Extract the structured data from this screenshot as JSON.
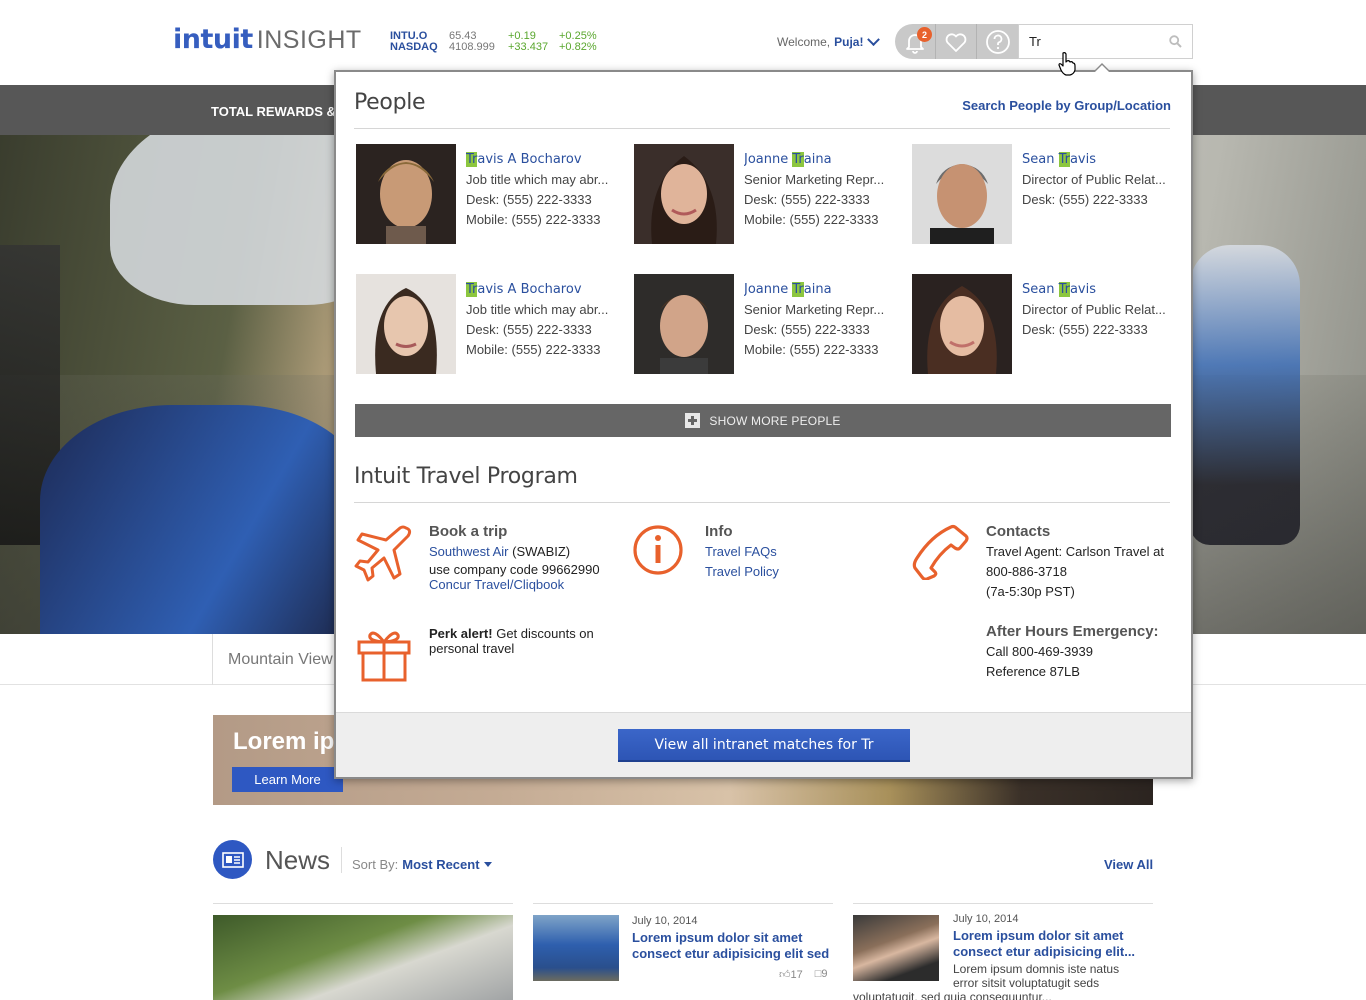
{
  "header": {
    "logo_main": "intuit",
    "logo_sub": "INSIGHT",
    "tickers": [
      {
        "name": "INTU.O",
        "value": "65.43",
        "change": "+0.19",
        "pct": "+0.25%"
      },
      {
        "name": "NASDAQ",
        "value": "4108.999",
        "change": "+33.437",
        "pct": "+0.82%"
      }
    ],
    "welcome": "Welcome,",
    "user": "Puja!",
    "notification_count": "2",
    "search_value": "Tr"
  },
  "nav": {
    "first_item": "TOTAL REWARDS &"
  },
  "location": "Mountain View",
  "banner": {
    "title": "Lorem ip",
    "button": "Learn More"
  },
  "dropdown": {
    "people_title": "People",
    "search_people_link": "Search People by Group/Location",
    "people": [
      {
        "pre": "",
        "hl": "Tr",
        "post": "avis A Bocharov",
        "title": "Job title which may abr...",
        "desk": "Desk: (555) 222-3333",
        "mobile": "Mobile: (555) 222-3333"
      },
      {
        "pre": "Joanne ",
        "hl": "Tr",
        "post": "aina",
        "title": "Senior Marketing Repr...",
        "desk": "Desk: (555) 222-3333",
        "mobile": "Mobile: (555) 222-3333"
      },
      {
        "pre": "Sean ",
        "hl": "Tr",
        "post": "avis",
        "title": "Director of Public Relat...",
        "desk": "Desk: (555) 222-3333",
        "mobile": ""
      },
      {
        "pre": "",
        "hl": "Tr",
        "post": "avis A Bocharov",
        "title": "Job title which may abr...",
        "desk": "Desk: (555) 222-3333",
        "mobile": "Mobile: (555) 222-3333"
      },
      {
        "pre": "Joanne ",
        "hl": "Tr",
        "post": "aina",
        "title": "Senior Marketing Repr...",
        "desk": "Desk: (555) 222-3333",
        "mobile": "Mobile: (555) 222-3333"
      },
      {
        "pre": "Sean ",
        "hl": "Tr",
        "post": "avis",
        "title": "Director of Public Relat...",
        "desk": "Desk: (555) 222-3333",
        "mobile": ""
      }
    ],
    "show_more": "SHOW MORE PEOPLE",
    "travel_title": "Intuit Travel Program",
    "book": {
      "head": "Book a trip",
      "airline_link": "Southwest Air",
      "airline_code": " (SWABIZ)",
      "company_code": "use company code 99662990",
      "concur_link": "Concur Travel/Cliqbook"
    },
    "info": {
      "head": "Info",
      "faqs": "Travel FAQs",
      "policy": "Travel Policy"
    },
    "contacts": {
      "head": "Contacts",
      "line1": "Travel Agent: Carlson Travel at",
      "line2": "800-886-3718",
      "line3": "(7a-5:30p PST)"
    },
    "perk": {
      "bold": "Perk alert!",
      "text": " Get discounts on",
      "text2": "personal travel"
    },
    "emergency": {
      "head": "After Hours Emergency:",
      "line1": "Call 800-469-3939",
      "line2": "Reference 87LB"
    },
    "footer_button": "View all intranet matches for Tr"
  },
  "news": {
    "title": "News",
    "sort_label": "Sort By:",
    "sort_value": "Most Recent",
    "view_all": "View All",
    "items": [
      {
        "date": "July 10, 2014",
        "headline1": "Lorem ipsum dolor sit amet",
        "headline2": "consect etur adipisicing elit sed",
        "likes": "17",
        "comments": "9"
      },
      {
        "date": "July 10, 2014",
        "headline1": "Lorem ipsum dolor sit amet",
        "headline2": "consect etur adipisicing elit...",
        "body1": "Lorem ipsum domnis iste natus",
        "body2": "error sitsit voluptatugit seds",
        "body3": "voluptatugit, sed quia consequuntur..."
      }
    ]
  },
  "colors": {
    "brand_blue": "#2a4f9e",
    "accent_orange": "#e8612c",
    "highlight_green": "#8cc63f",
    "nav_gray": "#575757"
  }
}
